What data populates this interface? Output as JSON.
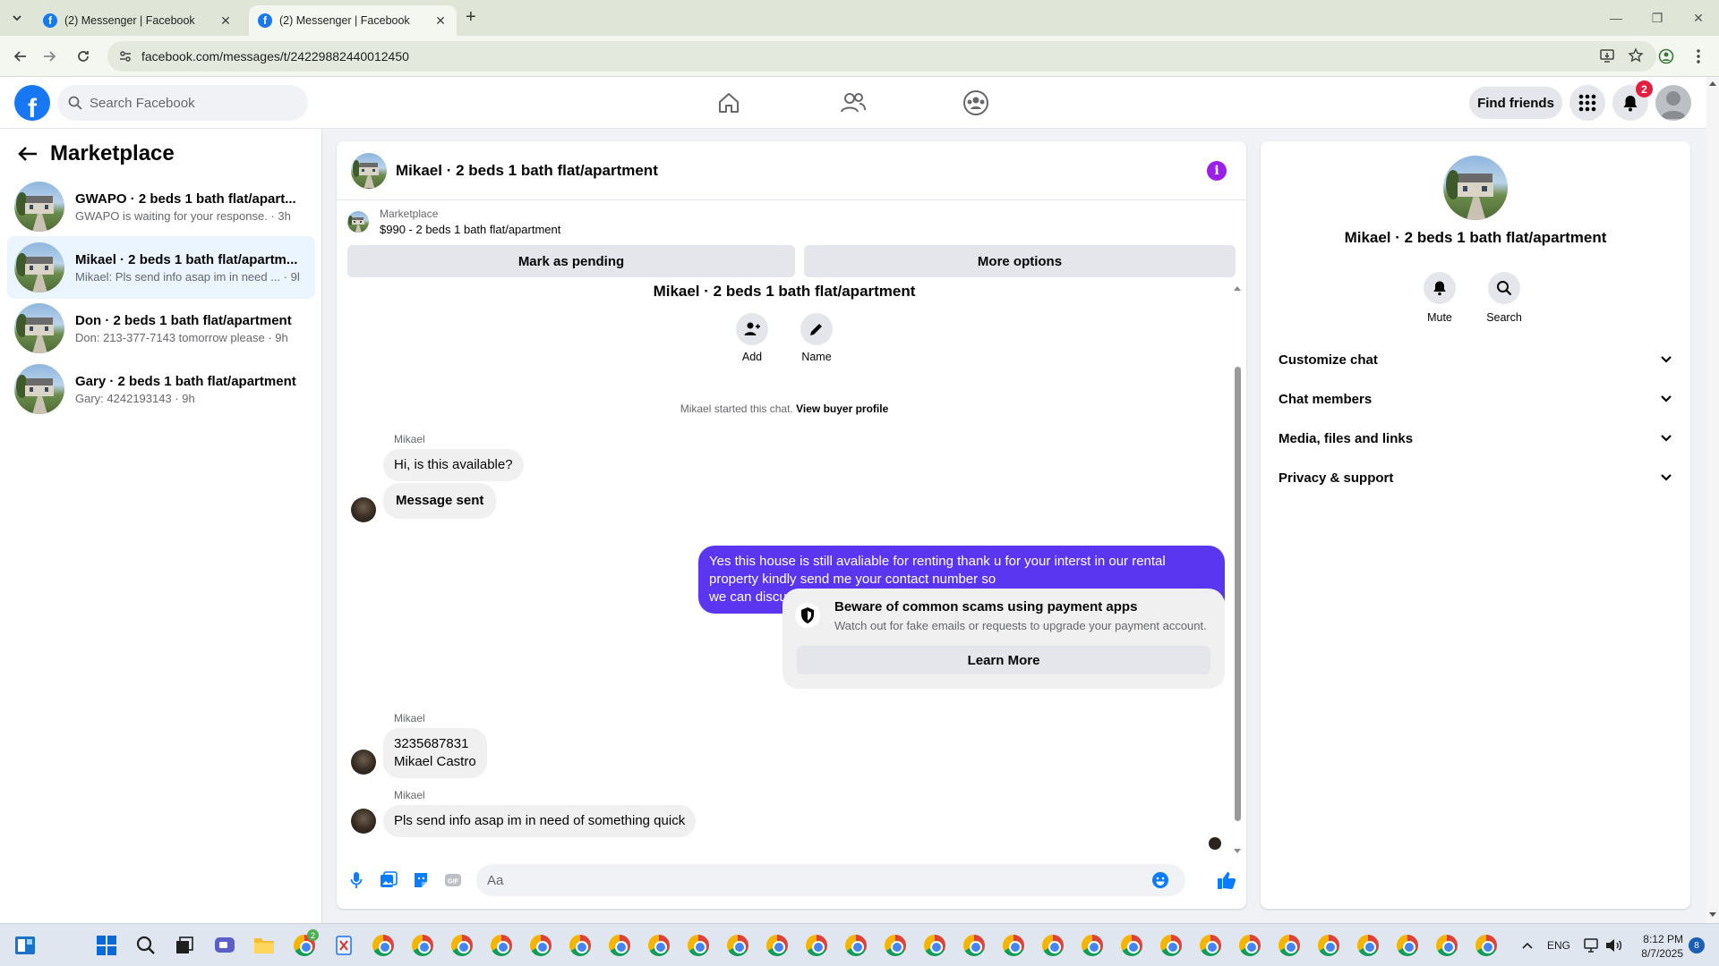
{
  "browser": {
    "tabs": [
      {
        "title": "(2) Messenger | Facebook",
        "active": false
      },
      {
        "title": "(2) Messenger | Facebook",
        "active": true
      }
    ],
    "url": "facebook.com/messages/t/24229882440012450"
  },
  "header": {
    "search_placeholder": "Search Facebook",
    "find_friends_label": "Find friends",
    "notification_count": "2",
    "brand_color": "#1877f2"
  },
  "sidebar": {
    "title": "Marketplace",
    "conversations": [
      {
        "name": "GWAPO · 2 beds 1 bath flat/apart...",
        "preview": "GWAPO is waiting for your response. · 3h",
        "selected": false
      },
      {
        "name": "Mikael · 2 beds 1 bath flat/apartm...",
        "preview": "Mikael: Pls send info asap im in need ... · 9h",
        "selected": true
      },
      {
        "name": "Don · 2 beds 1 bath flat/apartment",
        "preview": "Don: 213-377-7143 tomorrow please · 9h",
        "selected": false
      },
      {
        "name": "Gary · 2 beds 1 bath flat/apartment",
        "preview": "Gary: 4242193143 · 9h",
        "selected": false
      }
    ]
  },
  "chat": {
    "title": "Mikael · 2 beds 1 bath flat/apartment",
    "listing_label": "Marketplace",
    "listing_price": "$990 - 2 beds 1 bath flat/apartment",
    "mark_pending_label": "Mark as pending",
    "more_options_label": "More options",
    "intro_title": "Mikael · 2 beds 1 bath flat/apartment",
    "intro_actions": {
      "add": "Add",
      "name": "Name"
    },
    "started_text": "Mikael started this chat.",
    "view_buyer_profile": "View buyer profile",
    "messages": [
      {
        "sender": "Mikael",
        "text": "Hi, is this available?"
      },
      {
        "sender": "",
        "text": "Message sent"
      },
      {
        "sender": "me",
        "lines": [
          "Yes this house is still avaliable for renting thank u for your interst in our rental",
          "property kindly send me your contact number so",
          "we can discuss further details and requirment about the house"
        ]
      },
      {
        "sender": "Mikael",
        "lines": [
          "3235687831",
          "Mikael Castro"
        ]
      },
      {
        "sender": "Mikael",
        "text": "Pls send info asap im in need of something quick"
      }
    ],
    "sender_names": [
      "Mikael",
      "Mikael",
      "Mikael"
    ],
    "scam_warning": {
      "title": "Beware of common scams using payment apps",
      "subtitle": "Watch out for fake emails or requests to upgrade your payment account.",
      "button": "Learn More"
    },
    "composer_placeholder": "Aa",
    "outgoing_color": "#5a36f0",
    "accent_color": "#0a7cff"
  },
  "info_panel": {
    "name": "Mikael · 2 beds 1 bath flat/apartment",
    "actions": {
      "mute": "Mute",
      "search": "Search"
    },
    "sections": [
      "Customize chat",
      "Chat members",
      "Media, files and links",
      "Privacy & support"
    ]
  },
  "taskbar": {
    "language": "ENG",
    "time": "8:12 PM",
    "date": "8/7/2025",
    "notification_count": "8",
    "chrome_badges": [
      "2"
    ]
  }
}
